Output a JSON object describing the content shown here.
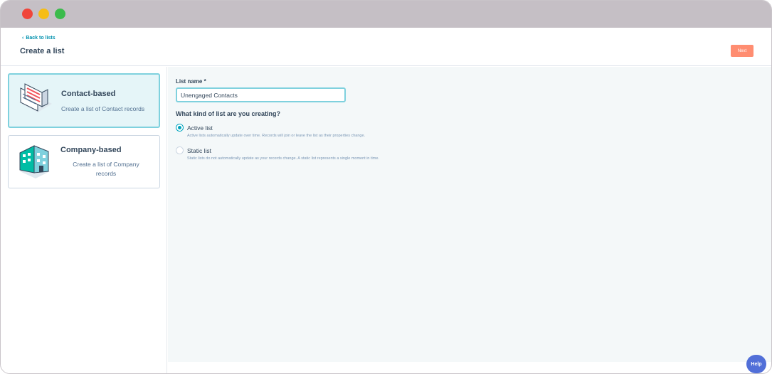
{
  "header": {
    "back_link": "Back to lists",
    "title": "Create a list",
    "next_label": "Next"
  },
  "object_types": [
    {
      "title": "Contact-based",
      "description": "Create a list of Contact records",
      "icon": "contact-card-icon",
      "selected": true
    },
    {
      "title": "Company-based",
      "description": "Create a list of Company records",
      "icon": "building-icon",
      "selected": false
    }
  ],
  "form": {
    "list_name_label": "List name *",
    "list_name_value": "Unengaged Contacts",
    "question": "What kind of list are you creating?",
    "options": [
      {
        "label": "Active list",
        "description": "Active lists automatically update over time. Records will join or leave the list as their properties change.",
        "checked": true
      },
      {
        "label": "Static list",
        "description": "Static lists do not automatically update as your records change. A static list represents a single moment in time.",
        "checked": false
      }
    ]
  },
  "help_label": "Help",
  "colors": {
    "accent": "#00a4bd",
    "primary_button": "#ff7a59",
    "selected_card_bg": "#e5f5f8"
  }
}
